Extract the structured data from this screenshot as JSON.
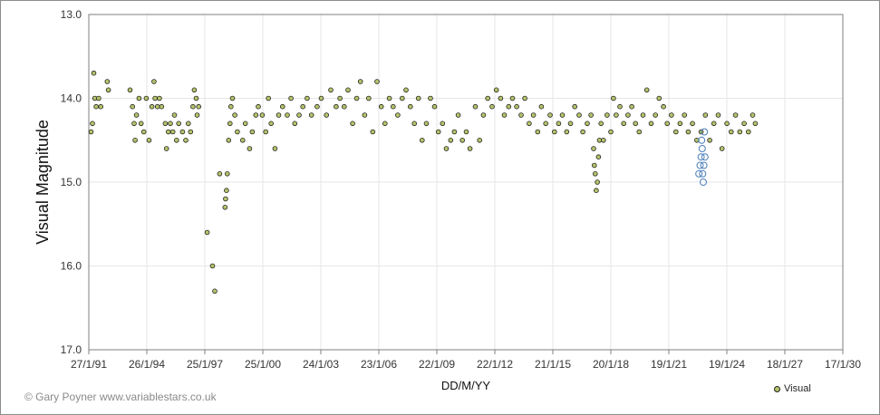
{
  "copyright": "© Gary Poyner  www.variablestars.co.uk",
  "colors": {
    "visual_fill": "#b5c46a",
    "visual_stroke": "#1f1f1f",
    "faint_stroke": "#4a7fb8",
    "grid": "#e6e6e6",
    "axis": "#7f7f7f"
  },
  "chart_data": {
    "type": "scatter",
    "title": "",
    "xlabel": "DD/M/YY",
    "ylabel": "Visual Magnitude",
    "y_inverted": true,
    "ylim": [
      13.0,
      17.0
    ],
    "yticks": [
      "13.0",
      "14.0",
      "15.0",
      "16.0",
      "17.0"
    ],
    "xlim": [
      "1991-01-27",
      "2030-01-17"
    ],
    "xticks": [
      "27/1/91",
      "26/1/94",
      "25/1/97",
      "25/1/00",
      "24/1/03",
      "23/1/06",
      "22/1/09",
      "22/1/12",
      "21/1/15",
      "20/1/18",
      "19/1/21",
      "19/1/24",
      "18/1/27",
      "17/1/30"
    ],
    "grid": true,
    "legend": {
      "position": "bottom-right",
      "entries": [
        "Visual"
      ]
    },
    "series": [
      {
        "name": "Visual",
        "marker": "filled-circle",
        "points": [
          [
            "1991-03-10",
            14.4
          ],
          [
            "1991-04-05",
            14.3
          ],
          [
            "1991-05-01",
            13.7
          ],
          [
            "1991-05-20",
            14.0
          ],
          [
            "1991-06-15",
            14.1
          ],
          [
            "1991-08-01",
            14.0
          ],
          [
            "1991-09-10",
            14.1
          ],
          [
            "1992-01-10",
            13.8
          ],
          [
            "1992-02-01",
            13.9
          ],
          [
            "1993-03-15",
            13.9
          ],
          [
            "1993-05-01",
            14.1
          ],
          [
            "1993-06-01",
            14.3
          ],
          [
            "1993-06-20",
            14.5
          ],
          [
            "1993-07-15",
            14.2
          ],
          [
            "1993-09-01",
            14.0
          ],
          [
            "1993-10-10",
            14.3
          ],
          [
            "1993-12-01",
            14.4
          ],
          [
            "1994-01-15",
            14.0
          ],
          [
            "1994-03-10",
            14.5
          ],
          [
            "1994-05-01",
            14.1
          ],
          [
            "1994-06-10",
            13.8
          ],
          [
            "1994-07-01",
            14.0
          ],
          [
            "1994-08-15",
            14.1
          ],
          [
            "1994-09-20",
            14.0
          ],
          [
            "1994-11-01",
            14.1
          ],
          [
            "1995-01-10",
            14.3
          ],
          [
            "1995-02-01",
            14.6
          ],
          [
            "1995-03-10",
            14.4
          ],
          [
            "1995-04-15",
            14.3
          ],
          [
            "1995-06-01",
            14.4
          ],
          [
            "1995-07-01",
            14.2
          ],
          [
            "1995-08-10",
            14.5
          ],
          [
            "1995-09-20",
            14.3
          ],
          [
            "1995-12-01",
            14.4
          ],
          [
            "1996-02-01",
            14.5
          ],
          [
            "1996-03-20",
            14.3
          ],
          [
            "1996-05-01",
            14.4
          ],
          [
            "1996-06-15",
            14.1
          ],
          [
            "1996-07-10",
            13.9
          ],
          [
            "1996-08-15",
            14.0
          ],
          [
            "1996-09-01",
            14.2
          ],
          [
            "1996-10-01",
            14.1
          ],
          [
            "1997-03-10",
            15.6
          ],
          [
            "1997-06-20",
            16.0
          ],
          [
            "1997-08-01",
            16.3
          ],
          [
            "1997-11-01",
            14.9
          ],
          [
            "1998-02-10",
            15.3
          ],
          [
            "1998-02-20",
            15.2
          ],
          [
            "1998-03-10",
            15.1
          ],
          [
            "1998-03-25",
            14.9
          ],
          [
            "1998-04-20",
            14.5
          ],
          [
            "1998-05-15",
            14.3
          ],
          [
            "1998-06-01",
            14.1
          ],
          [
            "1998-07-01",
            14.0
          ],
          [
            "1998-08-15",
            14.2
          ],
          [
            "1998-10-01",
            14.4
          ],
          [
            "1999-01-10",
            14.5
          ],
          [
            "1999-03-01",
            14.3
          ],
          [
            "1999-05-20",
            14.6
          ],
          [
            "1999-07-10",
            14.4
          ],
          [
            "1999-09-15",
            14.2
          ],
          [
            "1999-11-01",
            14.1
          ],
          [
            "2000-01-15",
            14.2
          ],
          [
            "2000-03-20",
            14.4
          ],
          [
            "2000-05-10",
            14.0
          ],
          [
            "2000-07-01",
            14.3
          ],
          [
            "2000-09-10",
            14.6
          ],
          [
            "2000-11-20",
            14.2
          ],
          [
            "2001-02-01",
            14.1
          ],
          [
            "2001-05-01",
            14.2
          ],
          [
            "2001-07-10",
            14.0
          ],
          [
            "2001-09-20",
            14.3
          ],
          [
            "2001-12-10",
            14.2
          ],
          [
            "2002-02-20",
            14.1
          ],
          [
            "2002-05-10",
            14.0
          ],
          [
            "2002-08-01",
            14.2
          ],
          [
            "2002-11-15",
            14.1
          ],
          [
            "2003-02-01",
            14.0
          ],
          [
            "2003-05-10",
            14.2
          ],
          [
            "2003-08-01",
            13.9
          ],
          [
            "2003-11-10",
            14.1
          ],
          [
            "2004-01-20",
            14.0
          ],
          [
            "2004-04-10",
            14.1
          ],
          [
            "2004-06-20",
            13.9
          ],
          [
            "2004-09-15",
            14.3
          ],
          [
            "2004-12-01",
            14.0
          ],
          [
            "2005-02-10",
            13.8
          ],
          [
            "2005-05-01",
            14.2
          ],
          [
            "2005-07-15",
            14.0
          ],
          [
            "2005-10-01",
            14.4
          ],
          [
            "2005-12-20",
            13.8
          ],
          [
            "2006-03-10",
            14.1
          ],
          [
            "2006-05-20",
            14.3
          ],
          [
            "2006-08-10",
            14.0
          ],
          [
            "2006-10-20",
            14.1
          ],
          [
            "2007-01-15",
            14.2
          ],
          [
            "2007-04-10",
            14.0
          ],
          [
            "2007-06-20",
            13.9
          ],
          [
            "2007-09-10",
            14.1
          ],
          [
            "2007-11-25",
            14.3
          ],
          [
            "2008-02-10",
            14.0
          ],
          [
            "2008-04-20",
            14.5
          ],
          [
            "2008-07-10",
            14.3
          ],
          [
            "2008-09-25",
            14.0
          ],
          [
            "2008-12-10",
            14.1
          ],
          [
            "2009-02-20",
            14.4
          ],
          [
            "2009-05-10",
            14.3
          ],
          [
            "2009-07-20",
            14.6
          ],
          [
            "2009-10-10",
            14.5
          ],
          [
            "2009-12-20",
            14.4
          ],
          [
            "2010-03-01",
            14.2
          ],
          [
            "2010-05-20",
            14.5
          ],
          [
            "2010-08-01",
            14.4
          ],
          [
            "2010-10-10",
            14.6
          ],
          [
            "2011-01-20",
            14.1
          ],
          [
            "2011-04-10",
            14.5
          ],
          [
            "2011-06-20",
            14.2
          ],
          [
            "2011-09-10",
            14.0
          ],
          [
            "2011-12-01",
            14.1
          ],
          [
            "2012-02-20",
            13.9
          ],
          [
            "2012-05-10",
            14.0
          ],
          [
            "2012-07-20",
            14.2
          ],
          [
            "2012-10-10",
            14.1
          ],
          [
            "2012-12-20",
            14.0
          ],
          [
            "2013-03-10",
            14.1
          ],
          [
            "2013-06-01",
            14.2
          ],
          [
            "2013-08-10",
            14.0
          ],
          [
            "2013-11-01",
            14.3
          ],
          [
            "2014-01-20",
            14.2
          ],
          [
            "2014-04-10",
            14.4
          ],
          [
            "2014-06-20",
            14.1
          ],
          [
            "2014-09-10",
            14.3
          ],
          [
            "2014-12-01",
            14.2
          ],
          [
            "2015-02-20",
            14.4
          ],
          [
            "2015-05-10",
            14.3
          ],
          [
            "2015-07-20",
            14.2
          ],
          [
            "2015-10-10",
            14.4
          ],
          [
            "2015-12-20",
            14.3
          ],
          [
            "2016-03-10",
            14.1
          ],
          [
            "2016-06-01",
            14.2
          ],
          [
            "2016-08-10",
            14.4
          ],
          [
            "2016-11-01",
            14.3
          ],
          [
            "2017-01-10",
            14.2
          ],
          [
            "2017-03-01",
            14.6
          ],
          [
            "2017-03-15",
            14.8
          ],
          [
            "2017-04-01",
            14.9
          ],
          [
            "2017-04-20",
            15.1
          ],
          [
            "2017-05-10",
            15.0
          ],
          [
            "2017-06-01",
            14.7
          ],
          [
            "2017-06-20",
            14.5
          ],
          [
            "2017-07-20",
            14.3
          ],
          [
            "2017-09-01",
            14.5
          ],
          [
            "2017-11-10",
            14.2
          ],
          [
            "2018-01-20",
            14.4
          ],
          [
            "2018-03-10",
            14.0
          ],
          [
            "2018-05-01",
            14.2
          ],
          [
            "2018-07-10",
            14.1
          ],
          [
            "2018-09-20",
            14.3
          ],
          [
            "2018-12-10",
            14.2
          ],
          [
            "2019-02-20",
            14.1
          ],
          [
            "2019-05-01",
            14.3
          ],
          [
            "2019-07-10",
            14.4
          ],
          [
            "2019-09-20",
            14.2
          ],
          [
            "2019-12-01",
            13.9
          ],
          [
            "2020-02-20",
            14.3
          ],
          [
            "2020-05-10",
            14.2
          ],
          [
            "2020-07-20",
            14.0
          ],
          [
            "2020-10-10",
            14.1
          ],
          [
            "2020-12-20",
            14.3
          ],
          [
            "2021-03-10",
            14.2
          ],
          [
            "2021-06-01",
            14.4
          ],
          [
            "2021-08-20",
            14.3
          ],
          [
            "2021-11-10",
            14.2
          ],
          [
            "2022-01-20",
            14.4
          ],
          [
            "2022-04-10",
            14.3
          ],
          [
            "2022-07-01",
            14.5
          ],
          [
            "2022-09-20",
            14.4
          ],
          [
            "2022-12-10",
            14.2
          ],
          [
            "2023-03-01",
            14.5
          ],
          [
            "2023-05-20",
            14.3
          ],
          [
            "2023-08-10",
            14.2
          ],
          [
            "2023-10-20",
            14.6
          ],
          [
            "2024-01-20",
            14.3
          ],
          [
            "2024-04-10",
            14.4
          ],
          [
            "2024-07-01",
            14.2
          ],
          [
            "2024-09-20",
            14.4
          ],
          [
            "2024-12-10",
            14.3
          ],
          [
            "2025-03-01",
            14.4
          ],
          [
            "2025-05-20",
            14.2
          ],
          [
            "2025-07-10",
            14.3
          ]
        ]
      },
      {
        "name": "",
        "marker": "open-circle",
        "points": [
          [
            "2022-08-10",
            14.9
          ],
          [
            "2022-09-01",
            14.8
          ],
          [
            "2022-09-20",
            14.7
          ],
          [
            "2022-10-01",
            14.5
          ],
          [
            "2022-10-10",
            14.6
          ],
          [
            "2022-10-20",
            14.9
          ],
          [
            "2022-11-01",
            15.0
          ],
          [
            "2022-11-10",
            14.8
          ],
          [
            "2022-11-20",
            14.4
          ],
          [
            "2022-12-01",
            14.7
          ]
        ]
      }
    ]
  }
}
